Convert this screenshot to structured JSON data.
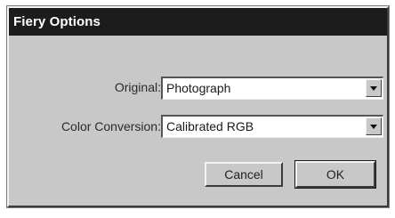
{
  "window": {
    "title": "Fiery Options"
  },
  "fields": {
    "original": {
      "label": "Original:",
      "value": "Photograph"
    },
    "color_conversion": {
      "label": "Color Conversion:",
      "value": "Calibrated RGB"
    }
  },
  "buttons": {
    "cancel_label": "Cancel",
    "ok_label": "OK"
  },
  "icons": {
    "dropdown": "chevron-down-icon"
  }
}
